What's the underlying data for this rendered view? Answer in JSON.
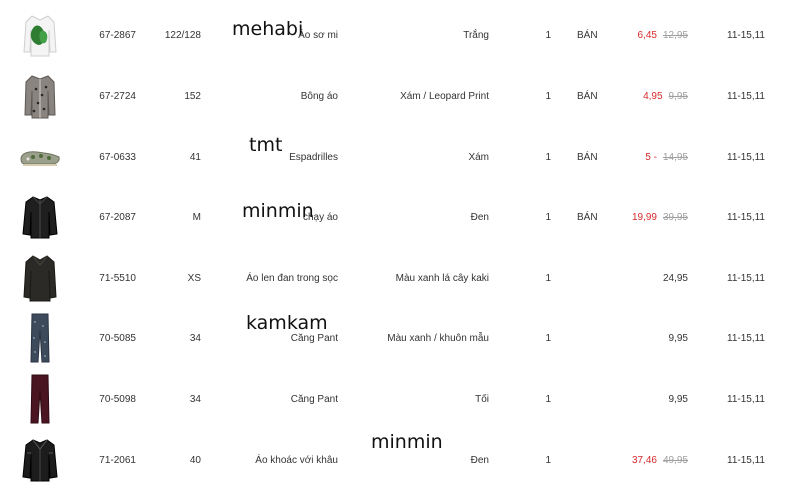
{
  "rows": [
    {
      "article": "67-2867",
      "size": "122/128",
      "description": "Áo sơ mi",
      "color": "Trắng",
      "qty": "1",
      "status": "BÁN",
      "price_sale": "6,45",
      "price_old": "12,95",
      "price": "",
      "date": "11-15,11",
      "thumb_icon": "shirt-icon"
    },
    {
      "article": "67-2724",
      "size": "152",
      "description": "Bông áo",
      "color": "Xám / Leopard Print",
      "qty": "1",
      "status": "BÁN",
      "price_sale": "4,95",
      "price_old": "9,95",
      "price": "",
      "date": "11-15,11",
      "thumb_icon": "shirt-icon"
    },
    {
      "article": "67-0633",
      "size": "41",
      "description": "Espadrilles",
      "color": "Xám",
      "qty": "1",
      "status": "BÁN",
      "price_sale": "5 -",
      "price_old": "14,95",
      "price": "",
      "date": "11-15,11",
      "thumb_icon": "shoe-icon"
    },
    {
      "article": "67-2087",
      "size": "M",
      "description": "chạy áo",
      "color": "Đen",
      "qty": "1",
      "status": "BÁN",
      "price_sale": "19,99",
      "price_old": "39,95",
      "price": "",
      "date": "11-15,11",
      "thumb_icon": "jacket-icon"
    },
    {
      "article": "71-5510",
      "size": "XS",
      "description": "Áo len đan trong sọc",
      "color": "Màu xanh lá cây kaki",
      "qty": "1",
      "status": "",
      "price_sale": "",
      "price_old": "",
      "price": "24,95",
      "date": "11-15,11",
      "thumb_icon": "sweater-icon"
    },
    {
      "article": "70-5085",
      "size": "34",
      "description": "Căng Pant",
      "color": "Màu xanh / khuôn mẫu",
      "qty": "1",
      "status": "",
      "price_sale": "",
      "price_old": "",
      "price": "9,95",
      "date": "11-15,11",
      "thumb_icon": "pants-icon"
    },
    {
      "article": "70-5098",
      "size": "34",
      "description": "Căng Pant",
      "color": "Tối",
      "qty": "1",
      "status": "",
      "price_sale": "",
      "price_old": "",
      "price": "9,95",
      "date": "11-15,11",
      "thumb_icon": "pants-icon"
    },
    {
      "article": "71-2061",
      "size": "40",
      "description": "Áo khoác với khâu",
      "color": "Đen",
      "qty": "1",
      "status": "",
      "price_sale": "37,46",
      "price_old": "49,95",
      "price": "",
      "date": "11-15,11",
      "thumb_icon": "jacket-icon"
    }
  ],
  "overlays": [
    "mehabi",
    "tmt",
    "minmin",
    "kamkam",
    "minmin"
  ],
  "colors": {
    "sale": "#d62b2b",
    "old": "#a0a0a0",
    "text": "#333333"
  }
}
